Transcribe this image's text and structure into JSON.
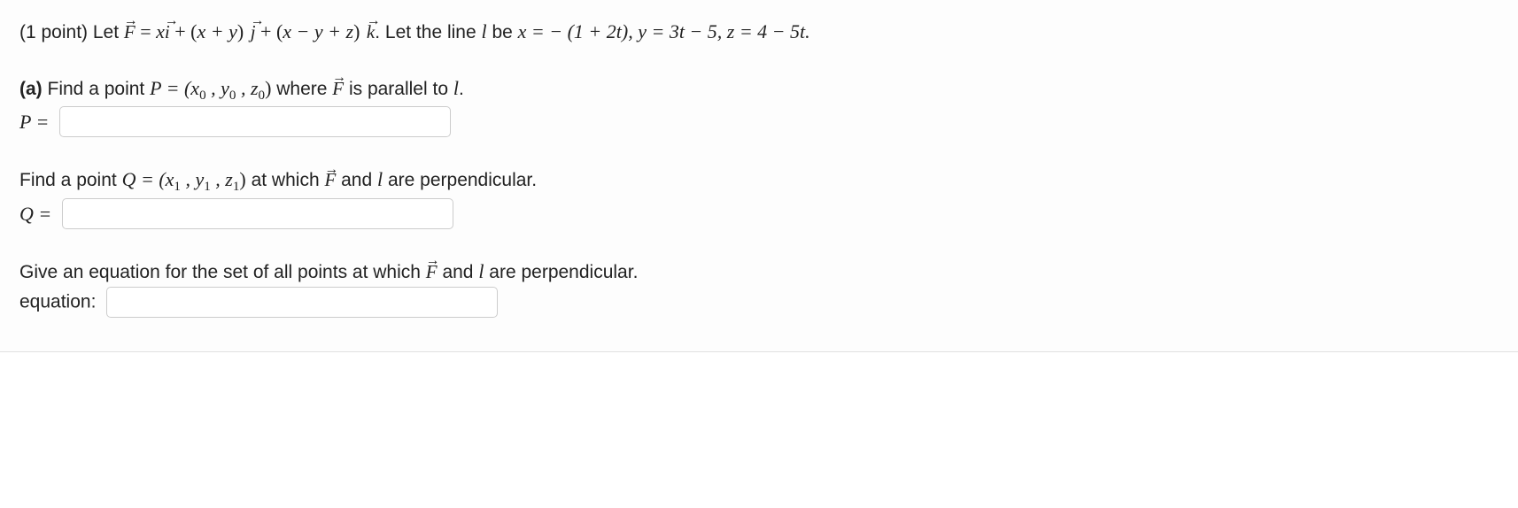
{
  "problem": {
    "points_prefix": "(1 point) Let ",
    "F": "F",
    "eq1_part1": " = ",
    "eq1_xi": "x",
    "i": "i",
    "eq1_part2": " + (",
    "eq1_xy": "x + y",
    "eq1_part3": ") ",
    "j": "j",
    "eq1_part4": " + (",
    "eq1_xyz": "x − y + z",
    "eq1_part5": ") ",
    "k": "k",
    "eq1_suffix": ". Let the line ",
    "l": "l",
    "eq1_be": " be ",
    "line_eq": "x = − (1 + 2t),  y = 3t − 5,  z = 4 − 5t."
  },
  "partA": {
    "label": "(a)",
    "text1": " Find a point ",
    "P": "P",
    "eqP": " = (x",
    "s0a": "0",
    "mid1": " , y",
    "s0b": "0",
    "mid2": " , z",
    "s0c": "0",
    "closeParen": ")",
    "text2": " where ",
    "F": "F",
    "text3": " is parallel to ",
    "l": "l",
    "period": ".",
    "input_label": "P ="
  },
  "partQ": {
    "text1": "Find a point ",
    "Q": "Q",
    "eqQ": " = (x",
    "s1a": "1",
    "mid1": " , y",
    "s1b": "1",
    "mid2": " , z",
    "s1c": "1",
    "closeParen": ")",
    "text2": " at which ",
    "F": "F",
    "text3": " and ",
    "l": "l",
    "text4": " are perpendicular.",
    "input_label": "Q ="
  },
  "partEq": {
    "text1": "Give an equation for the set of all points at which ",
    "F": "F",
    "text2": " and ",
    "l": "l",
    "text3": " are perpendicular.",
    "input_label": "equation:"
  }
}
